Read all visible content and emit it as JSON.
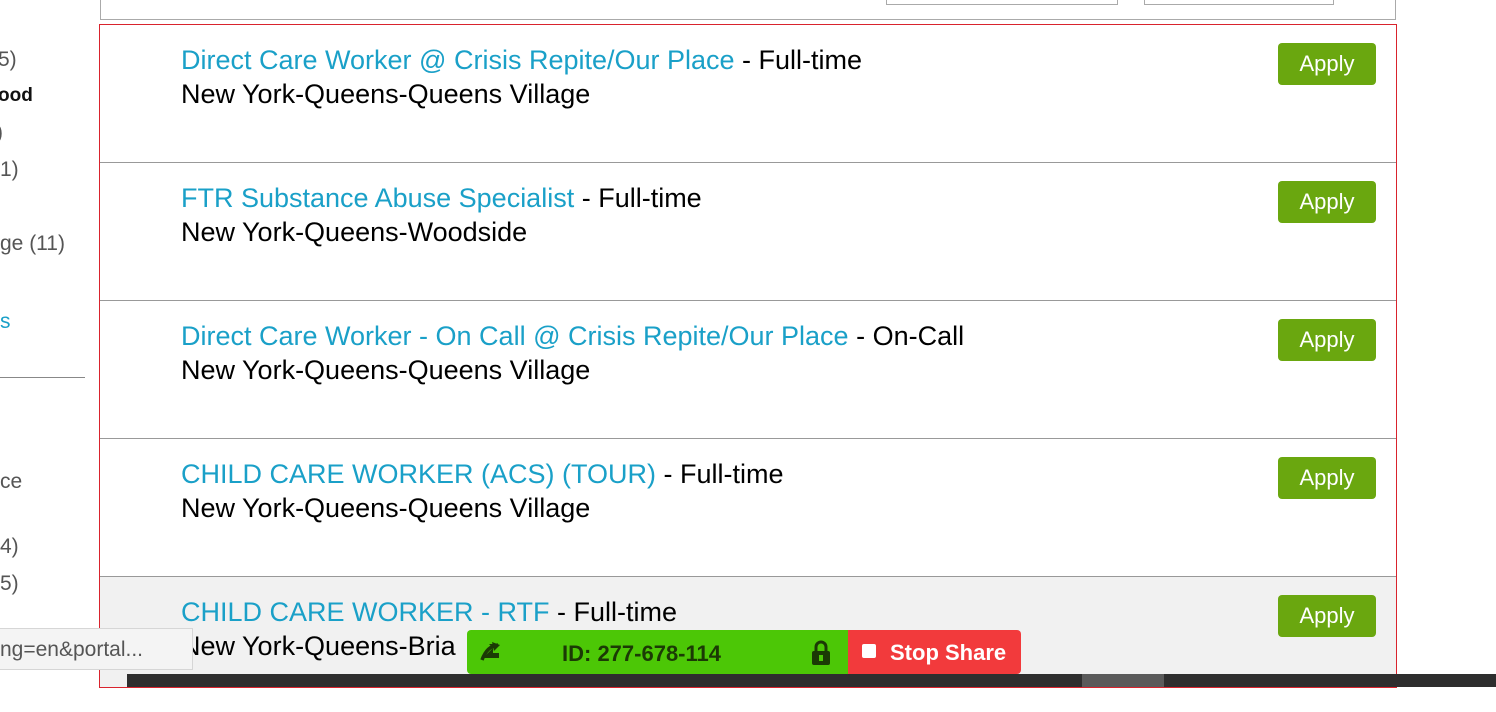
{
  "sidebar": {
    "fragments": [
      "5)",
      "ood",
      ")",
      "1)",
      "ge (11)",
      "s",
      "ce",
      "4)",
      "5)"
    ]
  },
  "jobs": [
    {
      "title": "Direct Care Worker @ Crisis Repite/Our Place",
      "type": " - Full-time",
      "location": "New York-Queens-Queens Village",
      "apply": "Apply"
    },
    {
      "title": "FTR Substance Abuse Specialist",
      "type": " - Full-time",
      "location": "New York-Queens-Woodside",
      "apply": "Apply"
    },
    {
      "title": "Direct Care Worker - On Call @ Crisis Repite/Our Place",
      "type": " - On-Call",
      "location": "New York-Queens-Queens Village",
      "apply": "Apply"
    },
    {
      "title": "CHILD CARE WORKER (ACS) (TOUR)",
      "type": " - Full-time",
      "location": "New York-Queens-Queens Village",
      "apply": "Apply"
    },
    {
      "title": "CHILD CARE WORKER - RTF",
      "type": " - Full-time",
      "location": "New York-Queens-Bria",
      "apply": "Apply"
    }
  ],
  "status_url": "ng=en&portal...",
  "share_bar": {
    "id_text": "ID: 277-678-114",
    "stop_label": "Stop Share"
  },
  "colors": {
    "link": "#1aa0c8",
    "apply": "#6aa70f",
    "share_green": "#4cc706",
    "stop_red": "#f23a3c",
    "list_border": "#d9232d"
  }
}
